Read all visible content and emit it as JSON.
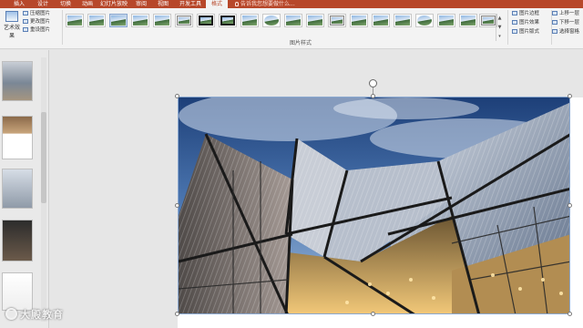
{
  "ribbon_tabs": [
    {
      "label": "插入",
      "active": false
    },
    {
      "label": "设计",
      "active": false
    },
    {
      "label": "切换",
      "active": false
    },
    {
      "label": "动画",
      "active": false
    },
    {
      "label": "幻灯片放映",
      "active": false
    },
    {
      "label": "审阅",
      "active": false
    },
    {
      "label": "视图",
      "active": false
    },
    {
      "label": "开发工具",
      "active": false
    },
    {
      "label": "格式",
      "active": true
    }
  ],
  "tell_me": "告诉我您想要做什么...",
  "adjust_group": {
    "art_effects": "艺术效果",
    "compress": "压缩图片",
    "change": "更改图片",
    "reset": "重设图片"
  },
  "picture_styles": {
    "group_label": "图片样式",
    "scroll_up": "▲",
    "scroll_down": "▼",
    "more": "▾",
    "border": "图片边框",
    "effects": "图片效果",
    "layout": "图片版式"
  },
  "arrange": {
    "bring_forward": "上移一层",
    "send_backward": "下移一层",
    "selection_pane": "选择窗格"
  },
  "watermark": "大殿教育",
  "colors": {
    "accent": "#b7472a",
    "ribbon_bg": "#f3f3f3",
    "canvas_bg": "#e6e6e6"
  }
}
